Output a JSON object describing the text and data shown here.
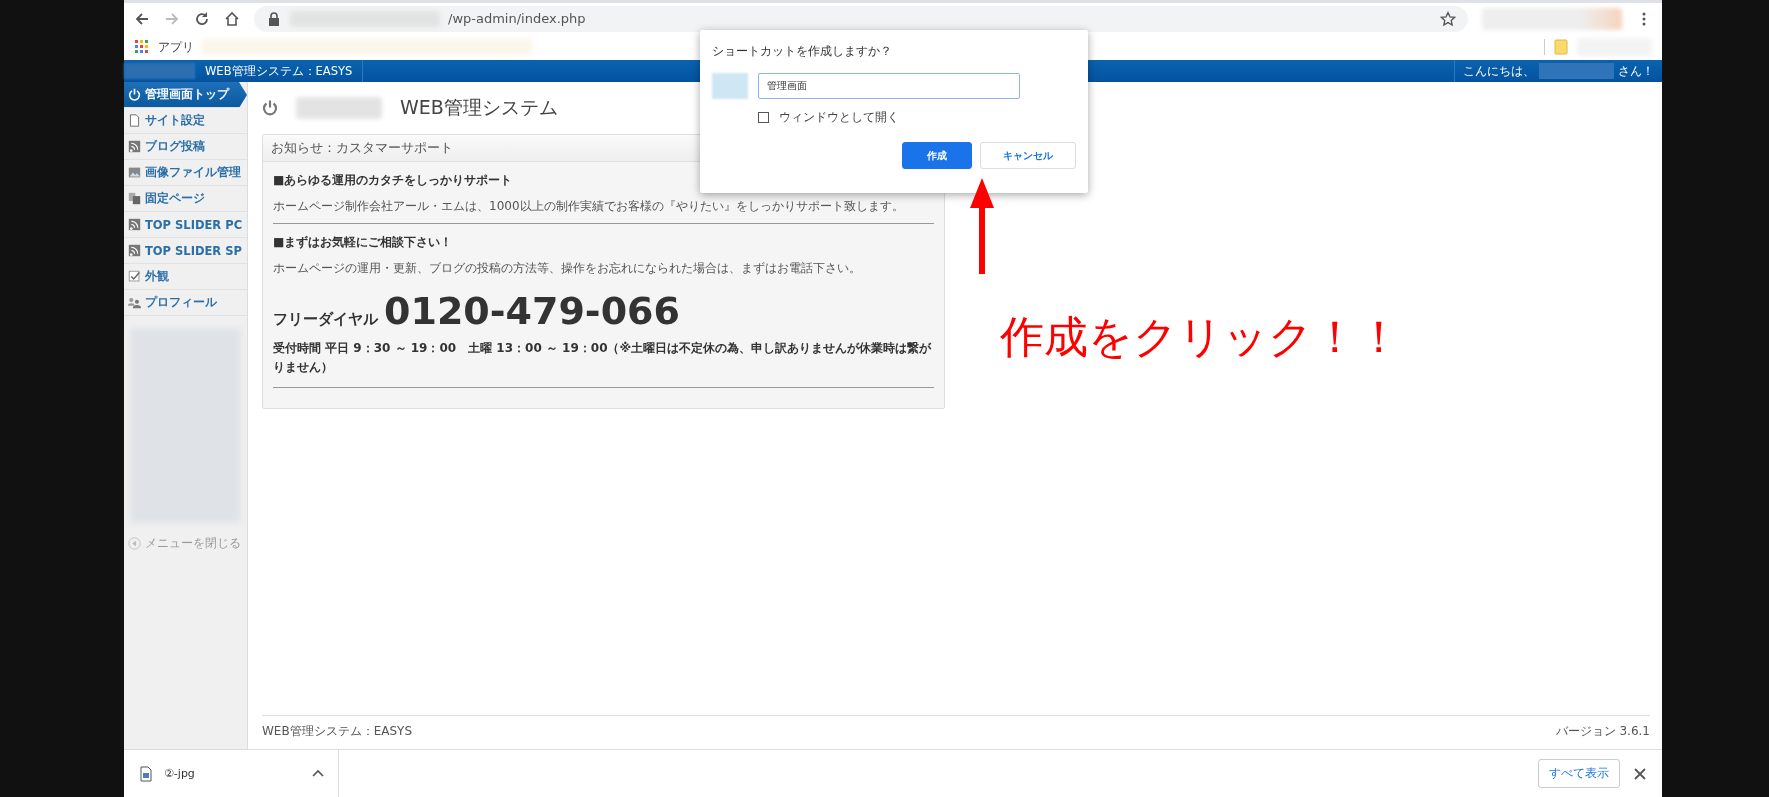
{
  "browser": {
    "url": "/wp-admin/index.php",
    "bookmarks": [
      {
        "label": "アプリ"
      }
    ]
  },
  "admin_bar": {
    "site_name": "WEB管理システム：EASYS",
    "greeting": "こんにちは、",
    "greeting_suffix": "さん！"
  },
  "sidebar": {
    "items": [
      {
        "label": "管理画面トップ",
        "kind": "power",
        "selected": true
      },
      {
        "label": "サイト設定",
        "kind": "page",
        "selected": false
      },
      {
        "label": "ブログ投稿",
        "kind": "feed",
        "selected": false
      },
      {
        "label": "画像ファイル管理",
        "kind": "image",
        "selected": false
      },
      {
        "label": "固定ページ",
        "kind": "pages",
        "selected": false
      },
      {
        "label": "TOP SLIDER PC",
        "kind": "feed",
        "selected": false
      },
      {
        "label": "TOP SLIDER SP",
        "kind": "feed",
        "selected": false
      },
      {
        "label": "外観",
        "kind": "check",
        "selected": false
      },
      {
        "label": "プロフィール",
        "kind": "users",
        "selected": false
      }
    ],
    "collapse": "メニューを閉じる"
  },
  "page": {
    "title": "WEB管理システム",
    "notice": {
      "title": "お知らせ：カスタマーサポート",
      "sections": [
        {
          "heading": "■あらゆる運用のカタチをしっかりサポート",
          "body": "ホームページ制作会社アール・エムは、1000以上の制作実績でお客様の『やりたい』をしっかりサポート致します。"
        },
        {
          "heading": "■まずはお気軽にご相談下さい！",
          "body": "ホームページの運用・更新、ブログの投稿の方法等、操作をお忘れになられた場合は、まずはお電話下さい。"
        }
      ],
      "dial_label": "フリーダイヤル",
      "phone": "0120-479-066",
      "hours": "受付時間 平日 9：30 ～ 19：00　土曜 13：00 ～ 19：00（※土曜日は不定休の為、申し訳ありませんが休業時は繋がりません）"
    }
  },
  "footer": {
    "left": "WEB管理システム：EASYS",
    "version": "バージョン 3.6.1"
  },
  "dialog": {
    "title": "ショートカットを作成しますか？",
    "name_value": "管理画面",
    "checkbox": {
      "label": "ウィンドウとして開く",
      "checked": false
    },
    "buttons": [
      {
        "label": "作成",
        "kind": "primary"
      },
      {
        "label": "キャンセル",
        "kind": "secondary"
      }
    ]
  },
  "annotation": {
    "text": "作成をクリック！！"
  },
  "download_bar": {
    "file": "②-jpg",
    "show_all": "すべて表示"
  }
}
